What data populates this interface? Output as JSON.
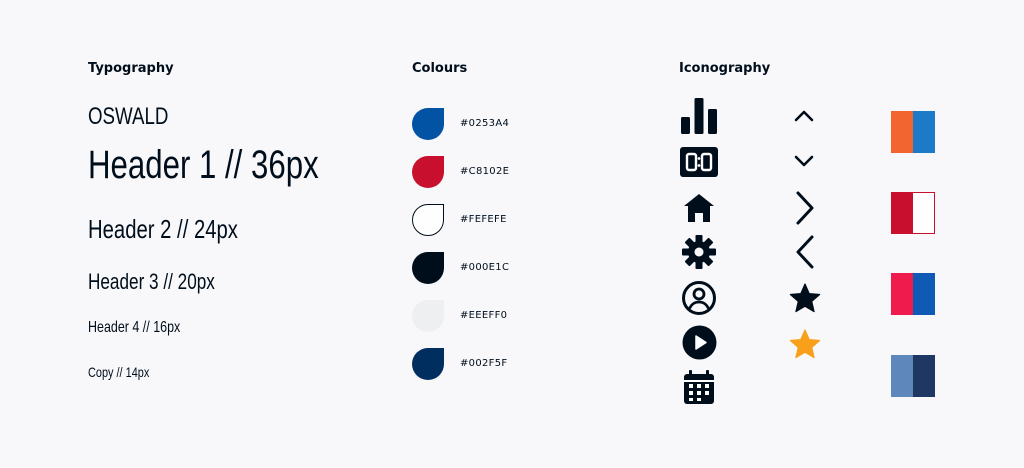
{
  "typography": {
    "title": "Typography",
    "font_name": "OSWALD",
    "h1": "Header 1 // 36px",
    "h2": "Header 2 // 24px",
    "h3": "Header 3 // 20px",
    "h4": "Header 4 // 16px",
    "copy": "Copy // 14px"
  },
  "colours": {
    "title": "Colours",
    "swatches": [
      {
        "hex": "#0253A4",
        "label": "#0253A4"
      },
      {
        "hex": "#C8102E",
        "label": "#C8102E"
      },
      {
        "hex": "#FEFEFE",
        "label": "#FEFEFE"
      },
      {
        "hex": "#000E1C",
        "label": "#000E1C"
      },
      {
        "hex": "#EEEFF0",
        "label": "#EEEFF0"
      },
      {
        "hex": "#002F5F",
        "label": "#002F5F"
      }
    ]
  },
  "iconography": {
    "title": "Iconography",
    "left_icons": [
      "bar-chart-icon",
      "scoreboard-icon",
      "home-icon",
      "gear-icon",
      "user-circle-icon",
      "play-circle-icon",
      "calendar-icon"
    ],
    "right_icons": [
      "chevron-up-icon",
      "chevron-down-icon",
      "chevron-right-icon",
      "chevron-left-icon",
      "star-icon",
      "star-filled-orange-icon"
    ],
    "star_accent": "#F9A01B",
    "color_pairs": [
      {
        "left": "#F26430",
        "right": "#1D7AC9"
      },
      {
        "left": "#C8102E",
        "right": "#FEFEFE"
      },
      {
        "left": "#EE1B4C",
        "right": "#0F5AB5"
      },
      {
        "left": "#5E87BB",
        "right": "#1F3763"
      }
    ]
  }
}
